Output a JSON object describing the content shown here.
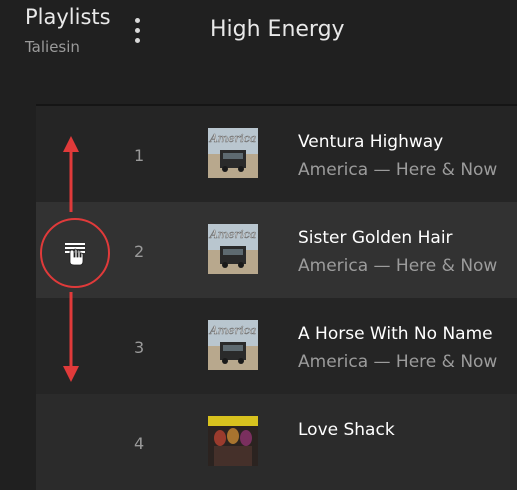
{
  "header": {
    "title": "Playlists",
    "subtitle": "Taliesin",
    "playlist_name": "High Energy",
    "menu_icon": "more-vertical-icon"
  },
  "tracks": [
    {
      "index": "1",
      "title": "Ventura Highway",
      "artist_album": "America — Here & Now",
      "art": "america-album-art"
    },
    {
      "index": "2",
      "title": "Sister Golden Hair",
      "artist_album": "America — Here & Now",
      "art": "america-album-art"
    },
    {
      "index": "3",
      "title": "A Horse With No Name",
      "artist_album": "America — Here & Now",
      "art": "america-album-art"
    },
    {
      "index": "4",
      "title": "Love Shack",
      "artist_album": "",
      "art": "b52s-album-art"
    }
  ],
  "drag_annotation": {
    "handle_icon": "drag-handle-hand-icon",
    "arrow_color": "#e03a3a"
  }
}
